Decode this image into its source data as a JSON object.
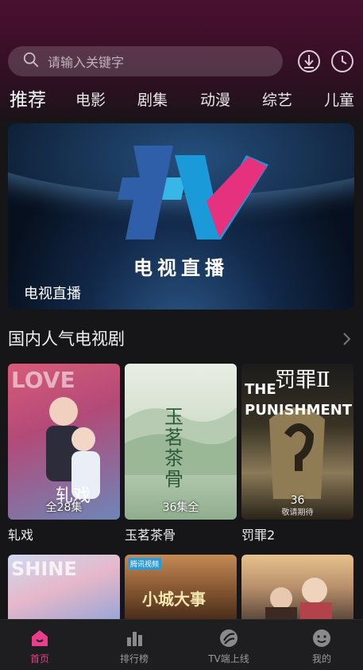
{
  "search": {
    "placeholder": "请输入关键字"
  },
  "tabs": [
    {
      "label": "推荐"
    },
    {
      "label": "电影"
    },
    {
      "label": "剧集"
    },
    {
      "label": "动漫"
    },
    {
      "label": "综艺"
    },
    {
      "label": "儿童"
    }
  ],
  "banner": {
    "logo_text": "电视直播",
    "caption": "电视直播"
  },
  "section": {
    "title": "国内人气电视剧"
  },
  "cards": [
    {
      "title": "轧戏",
      "episodes": "全28集",
      "poster_art": "LOVE",
      "poster_sub": "轧戏"
    },
    {
      "title": "玉茗茶骨",
      "episodes": "36集全",
      "poster_art": "玉茗茶骨"
    },
    {
      "title": "罚罪2",
      "episodes": "36",
      "poster_art": "THE PUNISHMENT",
      "poster_sub": "罚罪Ⅱ",
      "poster_note": "敬请期待"
    },
    {
      "title": "",
      "episodes": "",
      "poster_art": "SHINE"
    },
    {
      "title": "",
      "episodes": "",
      "poster_art": "小城大事",
      "poster_badge": "腾讯视频"
    },
    {
      "title": "",
      "episodes": "",
      "poster_art": ""
    }
  ],
  "nav": [
    {
      "label": "首页",
      "icon": "home-icon"
    },
    {
      "label": "排行榜",
      "icon": "chart-icon"
    },
    {
      "label": "TV端上线",
      "icon": "tv-icon"
    },
    {
      "label": "我的",
      "icon": "profile-icon"
    }
  ],
  "colors": {
    "accent": "#e83e8c",
    "background": "#161618"
  }
}
